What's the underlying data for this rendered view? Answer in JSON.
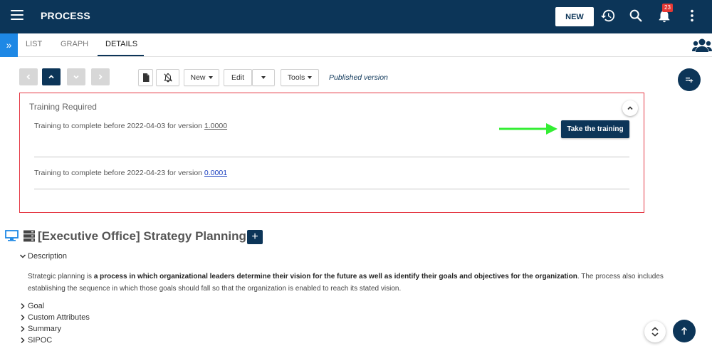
{
  "header": {
    "app_title": "PROCESS",
    "new_label": "NEW",
    "notification_count": "23"
  },
  "tabs": {
    "items": [
      {
        "label": "LIST"
      },
      {
        "label": "GRAPH"
      },
      {
        "label": "DETAILS"
      }
    ],
    "active": "DETAILS"
  },
  "toolbar": {
    "new_label": "New",
    "edit_label": "Edit",
    "tools_label": "Tools",
    "version_status": "Published version"
  },
  "training": {
    "title": "Training Required",
    "items": [
      {
        "text": "Training to complete before 2022-04-03 for version ",
        "version": "1.0000"
      },
      {
        "text": "Training to complete before 2022-04-23 for version ",
        "version": "0.0001"
      }
    ],
    "take_button": "Take the training"
  },
  "process": {
    "title": "[Executive Office] Strategy Planning",
    "add_label": "+"
  },
  "sections": {
    "description_label": "Description",
    "description_pre": "Strategic planning is ",
    "description_bold": "a process in which organizational leaders determine their vision for the future as well as identify their goals and objectives for the organization",
    "description_post": ". The process also includes establishing the sequence in which those goals should fall so that the organization is enabled to reach its stated vision.",
    "collapsed": [
      {
        "label": "Goal"
      },
      {
        "label": "Custom Attributes"
      },
      {
        "label": "Summary"
      },
      {
        "label": "SIPOC"
      }
    ]
  },
  "colors": {
    "primary": "#0c3558",
    "highlight_border": "#e53945",
    "arrow": "#33ee33",
    "badge": "#e53935",
    "tab_strip": "#1e88e5"
  }
}
